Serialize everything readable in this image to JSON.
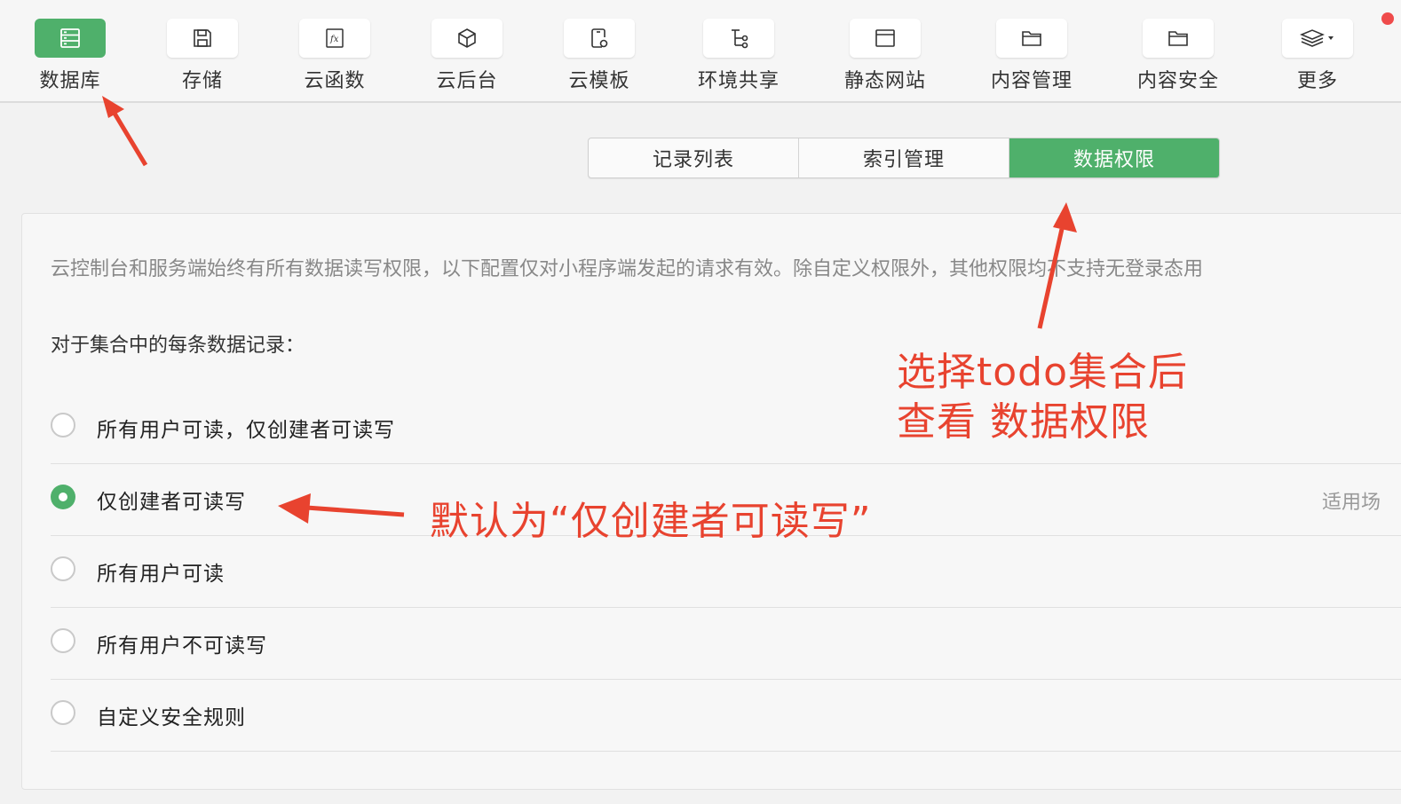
{
  "toolbar": {
    "items": [
      {
        "label": "数据库",
        "icon": "database-icon"
      },
      {
        "label": "存储",
        "icon": "storage-save-icon"
      },
      {
        "label": "云函数",
        "icon": "function-fx-icon"
      },
      {
        "label": "云后台",
        "icon": "cube-icon"
      },
      {
        "label": "云模板",
        "icon": "template-phone-icon"
      },
      {
        "label": "环境共享",
        "icon": "share-tree-icon"
      },
      {
        "label": "静态网站",
        "icon": "browser-window-icon"
      },
      {
        "label": "内容管理",
        "icon": "folder-icon"
      },
      {
        "label": "内容安全",
        "icon": "folder-icon"
      },
      {
        "label": "更多",
        "icon": "layers-dropdown-icon"
      }
    ],
    "active_index": 0,
    "accent_color": "#4fb06b",
    "notification_dot_color": "#ef4b4b"
  },
  "tabs": [
    "记录列表",
    "索引管理",
    "数据权限"
  ],
  "active_tab": 2,
  "panel": {
    "notice": "云控制台和服务端始终有所有数据读写权限，以下配置仅对小程序端发起的请求有效。除自定义权限外，其他权限均不支持无登录态用",
    "question": "对于集合中的每条数据记录：",
    "options": [
      {
        "label": "所有用户可读，仅创建者可读写",
        "checked": false
      },
      {
        "label": "仅创建者可读写",
        "checked": true
      },
      {
        "label": "所有用户可读",
        "checked": false
      },
      {
        "label": "所有用户不可读写",
        "checked": false
      },
      {
        "label": "自定义安全规则",
        "checked": false
      }
    ],
    "hint": "适用场"
  },
  "annotations": {
    "select_line1": "选择todo集合后",
    "select_line2": "查看 数据权限",
    "default_note": "默认为“仅创建者可读写”",
    "color": "#e8432f"
  }
}
